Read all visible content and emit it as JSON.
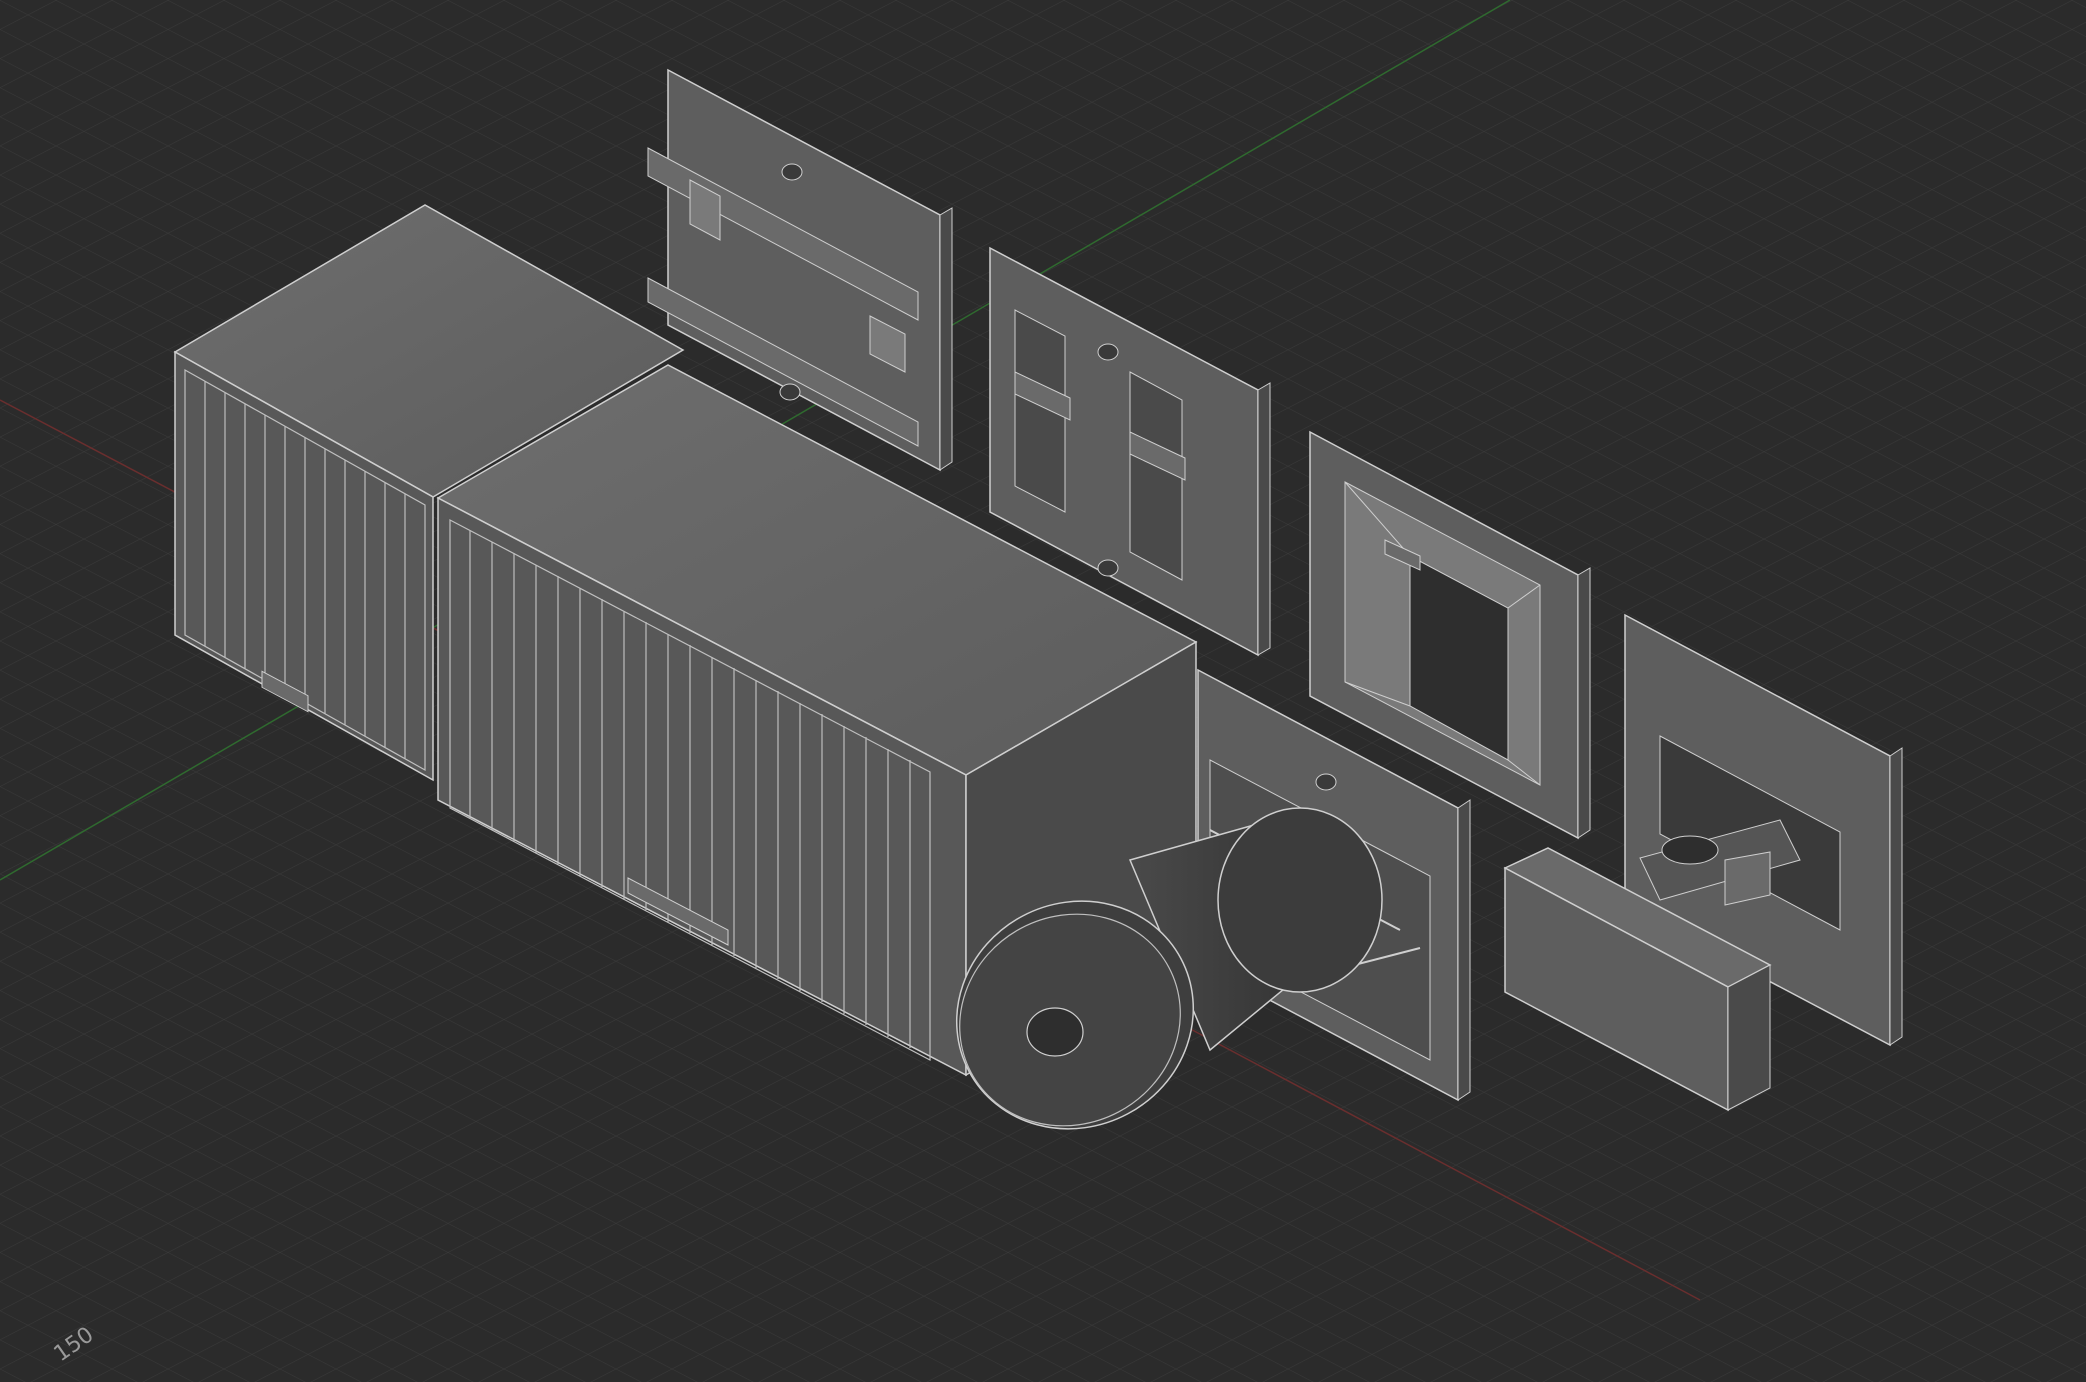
{
  "viewport": {
    "background": "#2b2b2b",
    "grid_color": "#3a3a3a",
    "grid_major_color": "#444444",
    "axis_x_color": "#7a2a2a",
    "axis_y_color": "#2f6a2f",
    "grid_label": "150"
  },
  "parts": [
    {
      "name": "enclosure-small",
      "kind": "box"
    },
    {
      "name": "enclosure-large",
      "kind": "box"
    },
    {
      "name": "panel-rail",
      "kind": "panel"
    },
    {
      "name": "panel-slots",
      "kind": "panel"
    },
    {
      "name": "panel-funnel",
      "kind": "panel"
    },
    {
      "name": "panel-lens-mount",
      "kind": "panel"
    },
    {
      "name": "lens-cylinder",
      "kind": "cylinder"
    },
    {
      "name": "panel-bracket",
      "kind": "panel"
    },
    {
      "name": "panel-clip",
      "kind": "panel"
    }
  ]
}
